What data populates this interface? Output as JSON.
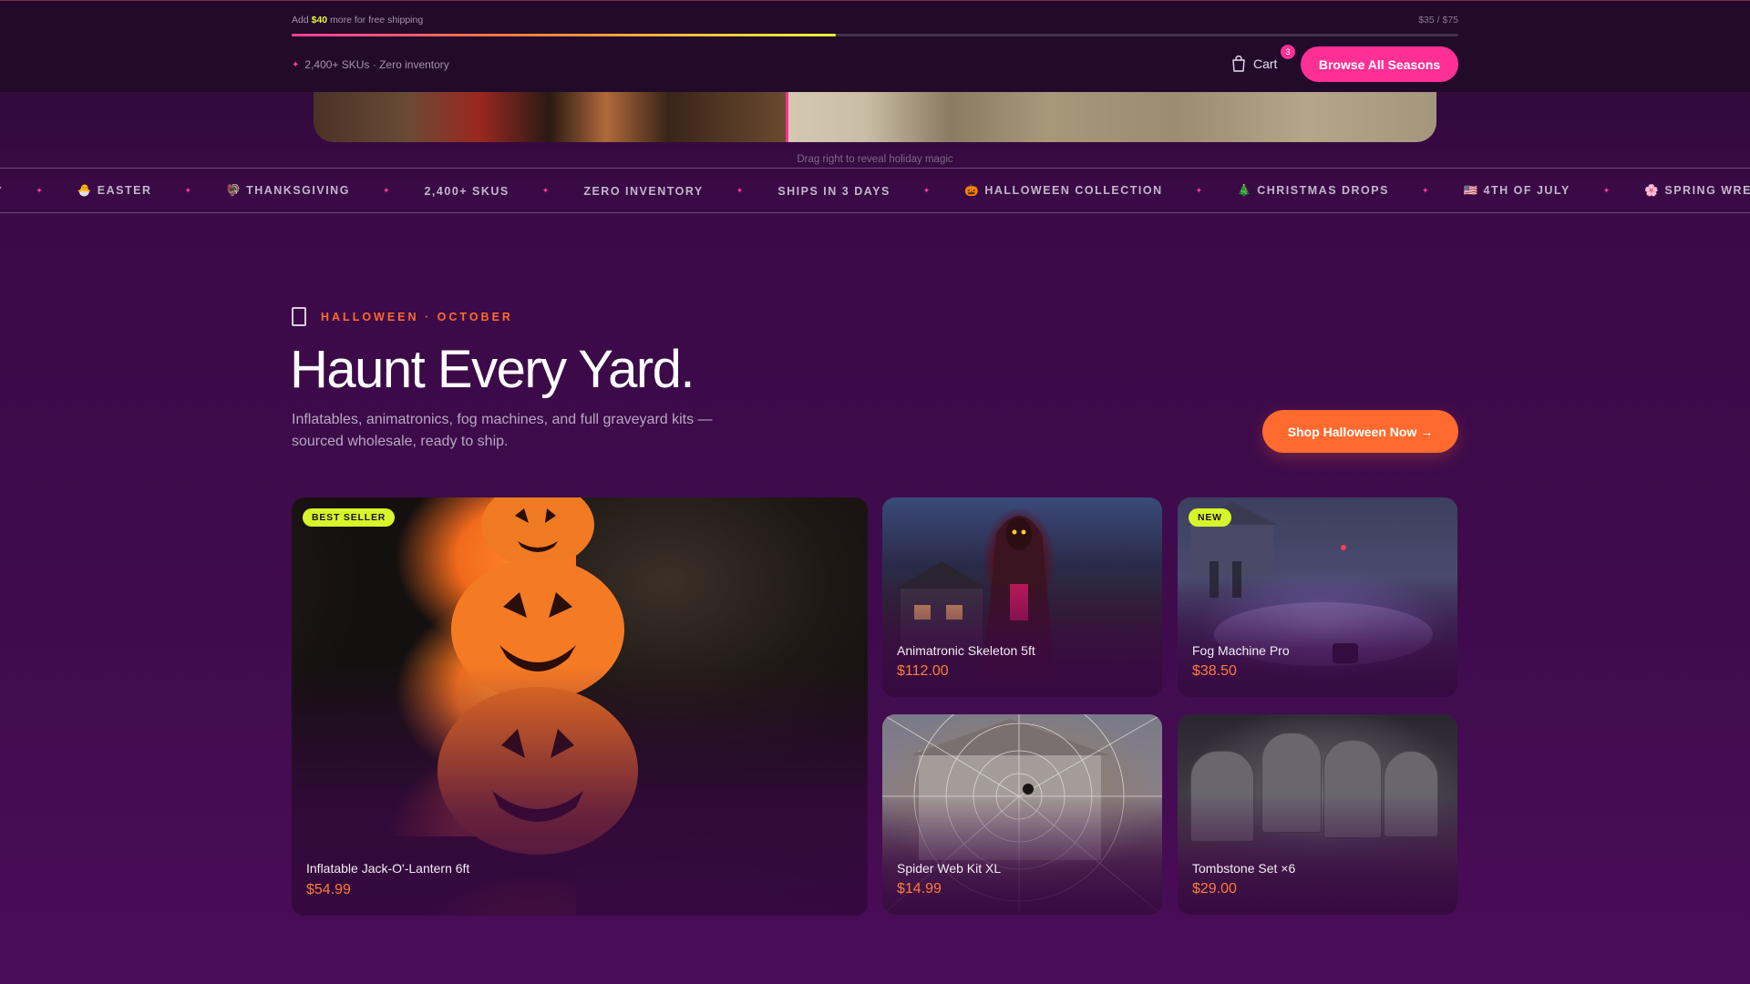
{
  "topbar": {
    "shipping": {
      "prefix": "Add",
      "amount": "$40",
      "suffix": "more for free shipping",
      "progress_text": "$35 / $75",
      "progress_fraction": 0.4667
    },
    "meta": "2,400+ SKUs · Zero inventory",
    "cart_label": "Cart",
    "cart_count": "3",
    "browse_button": "Browse All Seasons"
  },
  "hero": {
    "drag_hint": "Drag right to reveal holiday magic"
  },
  "marquee": {
    "items": [
      "AY",
      "🐣 EASTER",
      "🦃 THANKSGIVING",
      "2,400+ SKUS",
      "ZERO INVENTORY",
      "SHIPS IN 3 DAYS",
      "🎃 HALLOWEEN COLLECTION",
      "🎄 CHRISTMAS DROPS",
      "🇺🇸 4TH OF JULY",
      "🌸 SPRING WREATHS"
    ]
  },
  "section": {
    "eyebrow": "HALLOWEEN · OCTOBER",
    "title": "Haunt Every Yard.",
    "description": "Inflatables, animatronics, fog machines, and full graveyard kits — sourced wholesale, ready to ship.",
    "cta": "Shop Halloween Now →"
  },
  "products": [
    {
      "name": "Inflatable Jack-O'-Lantern 6ft",
      "price": "$54.99",
      "badge": "BEST SELLER"
    },
    {
      "name": "Animatronic Skeleton 5ft",
      "price": "$112.00",
      "badge": ""
    },
    {
      "name": "Fog Machine Pro",
      "price": "$38.50",
      "badge": "NEW"
    },
    {
      "name": "Spider Web Kit XL",
      "price": "$14.99",
      "badge": ""
    },
    {
      "name": "Tombstone Set ×6",
      "price": "$29.00",
      "badge": ""
    }
  ],
  "colors": {
    "accent_pink": "#ff2f95",
    "accent_orange": "#ff6a2f",
    "badge_lime": "#d6f52a"
  }
}
